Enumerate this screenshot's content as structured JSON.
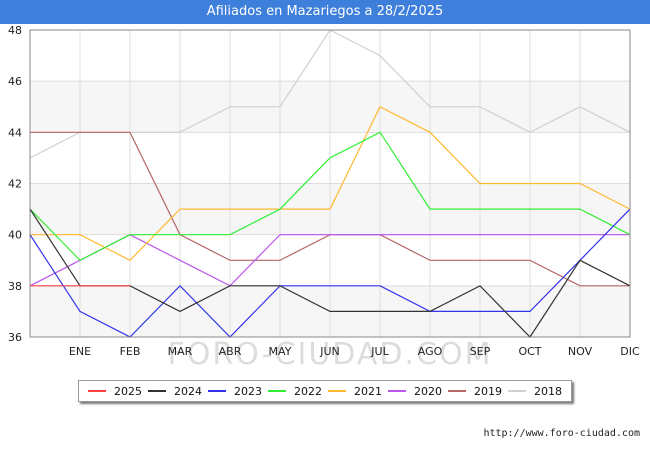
{
  "title": "Afiliados en Mazariegos a 28/2/2025",
  "source": "http://www.foro-ciudad.com",
  "watermark": "FORO-CIUDAD.COM",
  "chart_data": {
    "type": "line",
    "title": "Afiliados en Mazariegos a 28/2/2025",
    "xlabel": "",
    "ylabel": "",
    "categories": [
      "",
      "ENE",
      "FEB",
      "MAR",
      "ABR",
      "MAY",
      "JUN",
      "JUL",
      "AGO",
      "SEP",
      "OCT",
      "NOV",
      "DIC"
    ],
    "ylim": [
      36,
      48
    ],
    "yticks": [
      36,
      38,
      40,
      42,
      44,
      46,
      48
    ],
    "grid": true,
    "legend_position": "bottom",
    "series": [
      {
        "name": "2025",
        "color": "#ff4040",
        "values": [
          38,
          38,
          38,
          null,
          null,
          null,
          null,
          null,
          null,
          null,
          null,
          null,
          null
        ]
      },
      {
        "name": "2024",
        "color": "#333333",
        "values": [
          41,
          38,
          38,
          37,
          38,
          38,
          37,
          37,
          37,
          38,
          36,
          39,
          38
        ]
      },
      {
        "name": "2023",
        "color": "#3333ee",
        "values": [
          40,
          37,
          36,
          38,
          36,
          38,
          38,
          38,
          37,
          37,
          37,
          39,
          41
        ]
      },
      {
        "name": "2022",
        "color": "#33ee33",
        "values": [
          41,
          39,
          40,
          40,
          40,
          41,
          43,
          44,
          41,
          41,
          41,
          41,
          40
        ]
      },
      {
        "name": "2021",
        "color": "#ffb833",
        "values": [
          40,
          40,
          39,
          41,
          41,
          41,
          41,
          45,
          44,
          42,
          42,
          42,
          41
        ]
      },
      {
        "name": "2020",
        "color": "#bb55ee",
        "values": [
          38,
          39,
          40,
          39,
          38,
          40,
          40,
          40,
          40,
          40,
          40,
          40,
          40
        ]
      },
      {
        "name": "2019",
        "color": "#b86666",
        "values": [
          44,
          44,
          44,
          40,
          39,
          39,
          40,
          40,
          39,
          39,
          39,
          38,
          38
        ]
      },
      {
        "name": "2018",
        "color": "#d0d0d0",
        "values": [
          43,
          44,
          44,
          44,
          45,
          45,
          48,
          47,
          45,
          45,
          44,
          45,
          44
        ]
      }
    ]
  }
}
